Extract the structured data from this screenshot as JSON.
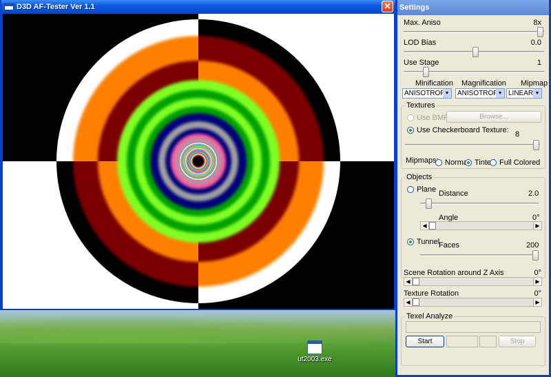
{
  "main_window": {
    "title": "D3D AF-Tester Ver 1.1",
    "close_glyph": "✕"
  },
  "desktop": {
    "icon_label": "ut2003.exe"
  },
  "settings": {
    "title": "Settings",
    "max_aniso": {
      "label": "Max. Aniso",
      "value": "8x"
    },
    "lod_bias": {
      "label": "LOD Bias",
      "value": "0.0"
    },
    "use_stage": {
      "label": "Use Stage",
      "value": "1"
    },
    "filters": {
      "minification_label": "Minification",
      "magnification_label": "Magnification",
      "mipmap_label": "Mipmap",
      "minification_value": "ANISOTROPIC",
      "magnification_value": "ANISOTROPIC",
      "mipmap_value": "LINEAR"
    },
    "textures": {
      "group_label": "Textures",
      "use_bmp": "Use BMP",
      "browse": "Browse...",
      "use_checkerboard": "Use Checkerboard Texture:",
      "checkerboard_value": "8",
      "mipmaps_label": "Mipmaps:",
      "mip_normal": "Normal",
      "mip_tinted": "Tinted",
      "mip_full": "Full Colored"
    },
    "objects": {
      "group_label": "Objects",
      "plane": "Plane",
      "distance_label": "Distance",
      "distance_value": "2.0",
      "angle_label": "Angle",
      "angle_value": "0°",
      "tunnel": "Tunnel",
      "faces_label": "Faces",
      "faces_value": "200"
    },
    "scene_rotation": {
      "label": "Scene Rotation around Z Axis",
      "value": "0°"
    },
    "texture_rotation": {
      "label": "Texture Rotation",
      "value": "0°"
    },
    "texel_analyze": {
      "group_label": "Texel Analyze",
      "start": "Start",
      "stop": "Stop"
    }
  },
  "colors": {
    "ring_colors": [
      "#000000",
      "#ffffff",
      "#ff8000",
      "#7a0000",
      "#00a000",
      "#00c000",
      "#80ff20",
      "#00007a",
      "#a0a0a0",
      "#ff60a0"
    ]
  }
}
